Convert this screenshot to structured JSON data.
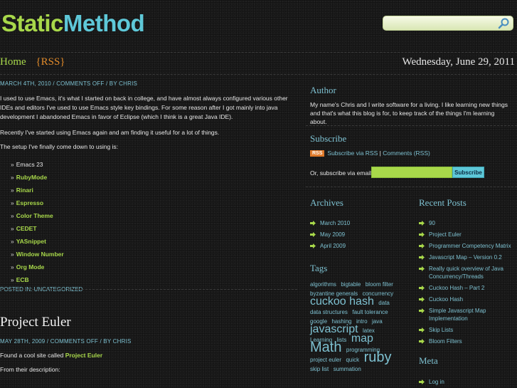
{
  "site": {
    "title_part1": "Static",
    "title_part2": "Method"
  },
  "search": {
    "placeholder": ""
  },
  "nav": {
    "home": "Home",
    "rss": "{RSS}",
    "date": "Wednesday, June 29, 2011"
  },
  "post1": {
    "meta_date": "March 4th, 2010",
    "meta_comments": "Comments Off",
    "meta_by": "/ by",
    "meta_author": "Chris",
    "para1": "I used to use Emacs, it's what I started on back in college, and have almost always configured various other IDEs and editors I've used to use Emacs style key bindings. For some reason after I got mainly into java development I abandoned Emacs in favor of Eclipse (which I think is a great Java IDE).",
    "para2": "Recently I've started using Emacs again and am finding it useful for a lot of things.",
    "para3": "The setup I've finally come down to using is:",
    "items": [
      {
        "label": "Emacs 23",
        "link": false
      },
      {
        "label": "RubyMode",
        "link": true
      },
      {
        "label": "Rinari",
        "link": true
      },
      {
        "label": "Espresso",
        "link": true
      },
      {
        "label": "Color Theme",
        "link": true
      },
      {
        "label": "CEDET",
        "link": true
      },
      {
        "label": "YASnippet",
        "link": true
      },
      {
        "label": "Window Number",
        "link": true
      },
      {
        "label": "Org Mode",
        "link": true
      },
      {
        "label": "ECB",
        "link": true
      }
    ],
    "posted_in": "Posted in:",
    "category": "Uncategorized"
  },
  "post2": {
    "title": "Project Euler",
    "meta_date": "May 28th, 2009",
    "meta_comments": "Comments Off",
    "meta_by": "/ by",
    "meta_author": "Chris",
    "para1_text": "Found a cool site called",
    "para1_link": "Project Euler",
    "para2": "From their description:"
  },
  "sidebar": {
    "author_heading": "Author",
    "author_text": "My name's Chris and I write software for a living. I like learning new things and that's what this blog is for, to keep track of the things I'm learning about.",
    "subscribe_heading": "Subscribe",
    "rss_badge": "RSS",
    "subscribe_rss": "Subscribe via RSS",
    "comments_rss": "Comments (RSS)",
    "email_label": "Or, subscribe via email:",
    "subscribe_button": "Subscribe",
    "archives_heading": "Archives",
    "archives": [
      "March 2010",
      "May 2009",
      "April 2009"
    ],
    "recent_heading": "Recent Posts",
    "recent": [
      "90",
      "Project Euler",
      "Programmer Competency Matrix",
      "Javascript Map – Version 0.2",
      "Really quick overview of Java Concurrency/Threads",
      "Cuckoo Hash – Part 2",
      "Cuckoo Hash",
      "Simple Javascript Map Implementation",
      "Skip Lists",
      "Bloom Filters"
    ],
    "tags_heading": "Tags",
    "tags": [
      {
        "t": "algorithms",
        "s": 8
      },
      {
        "t": "bigtable",
        "s": 8
      },
      {
        "t": "bloom filter",
        "s": 8
      },
      {
        "t": "byzantine generals",
        "s": 8
      },
      {
        "t": "concurrency",
        "s": 8
      },
      {
        "t": "cuckoo hash",
        "s": 16
      },
      {
        "t": "data",
        "s": 8
      },
      {
        "t": "data structures",
        "s": 8
      },
      {
        "t": "fault tolerance",
        "s": 8
      },
      {
        "t": "google",
        "s": 8
      },
      {
        "t": "hashing",
        "s": 8
      },
      {
        "t": "intro",
        "s": 8
      },
      {
        "t": "java",
        "s": 8
      },
      {
        "t": "javascript",
        "s": 16
      },
      {
        "t": "latex",
        "s": 8
      },
      {
        "t": "Learning",
        "s": 8
      },
      {
        "t": "lists",
        "s": 8
      },
      {
        "t": "map",
        "s": 16
      },
      {
        "t": "Math",
        "s": 20
      },
      {
        "t": "programming",
        "s": 8
      },
      {
        "t": "project euler",
        "s": 8
      },
      {
        "t": "quick",
        "s": 8
      },
      {
        "t": "ruby",
        "s": 20
      },
      {
        "t": "skip list",
        "s": 8
      },
      {
        "t": "summation",
        "s": 8
      }
    ],
    "meta_heading": "Meta",
    "meta_links": [
      "Log in"
    ]
  },
  "colors": {
    "green": "#a8d84a",
    "cyan": "#5ec8d8",
    "orange": "#e07a2a"
  }
}
